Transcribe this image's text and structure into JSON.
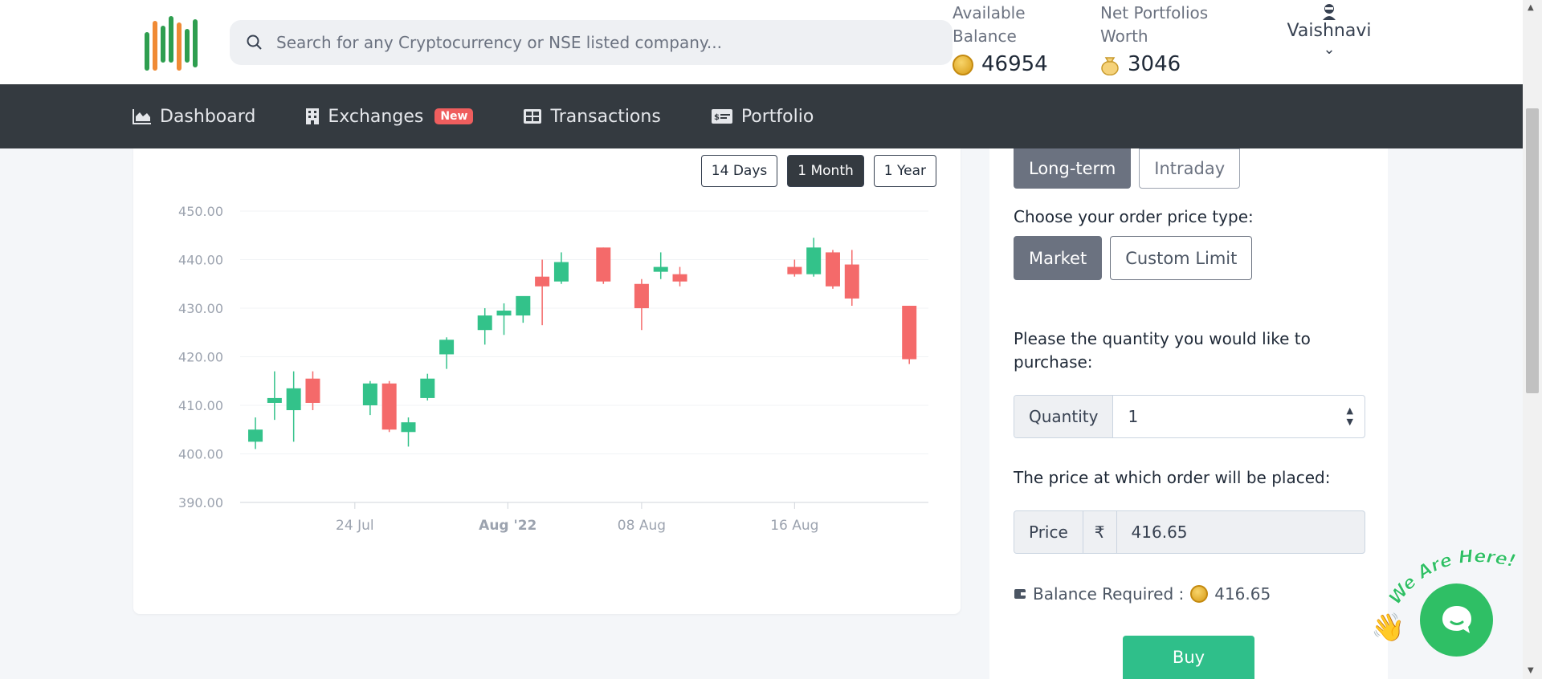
{
  "header": {
    "search_placeholder": "Search for any Cryptocurrency or NSE listed company...",
    "available_balance_label": "Available Balance",
    "available_balance": "46954",
    "net_worth_label": "Net Portfolios Worth",
    "net_worth": "3046",
    "user_name": "Vaishnavi"
  },
  "nav": [
    {
      "label": "Dashboard",
      "icon": "chart-area-icon"
    },
    {
      "label": "Exchanges",
      "icon": "building-icon",
      "badge": "New"
    },
    {
      "label": "Transactions",
      "icon": "table-icon"
    },
    {
      "label": "Portfolio",
      "icon": "money-check-icon"
    }
  ],
  "range_buttons": [
    "14 Days",
    "1 Month",
    "1 Year"
  ],
  "range_selected": "1 Month",
  "order": {
    "tabs": [
      "Long-term",
      "Intraday"
    ],
    "tab_selected": "Long-term",
    "price_type_label": "Choose your order price type:",
    "price_types": [
      "Market",
      "Custom Limit"
    ],
    "price_type_selected": "Market",
    "quantity_prompt": "Please the quantity you would like to purchase:",
    "quantity_label": "Quantity",
    "quantity_value": "1",
    "price_prompt": "The price at which order will be placed:",
    "price_label": "Price",
    "currency_symbol": "₹",
    "price_value": "416.65",
    "balance_required_label": "Balance Required :",
    "balance_required": "416.65",
    "buy_label": "Buy"
  },
  "chat": {
    "banner": "We Are Here!"
  },
  "colors": {
    "up": "#33c28a",
    "down": "#f46a6a",
    "nav_bg": "#343a40",
    "buy": "#2fbf8a"
  },
  "chart_data": {
    "type": "candlestick",
    "ylim": [
      390,
      450
    ],
    "y_ticks": [
      "450.00",
      "440.00",
      "430.00",
      "420.00",
      "410.00",
      "400.00",
      "390.00"
    ],
    "x_ticks": [
      {
        "label": "24 Jul",
        "day": 6,
        "bold": false
      },
      {
        "label": "Aug '22",
        "day": 14,
        "bold": true
      },
      {
        "label": "08 Aug",
        "day": 21,
        "bold": false
      },
      {
        "label": "16 Aug",
        "day": 29,
        "bold": false
      }
    ],
    "candles": [
      {
        "day": 0.8,
        "o": 402.5,
        "h": 407.5,
        "l": 401,
        "c": 405
      },
      {
        "day": 1.8,
        "o": 410.5,
        "h": 417,
        "l": 407,
        "c": 411.5
      },
      {
        "day": 2.8,
        "o": 409,
        "h": 417,
        "l": 402.5,
        "c": 413.5
      },
      {
        "day": 3.8,
        "o": 415.5,
        "h": 417,
        "l": 409,
        "c": 410.5
      },
      {
        "day": 6.8,
        "o": 410,
        "h": 415,
        "l": 408,
        "c": 414.5
      },
      {
        "day": 7.8,
        "o": 414.5,
        "h": 415,
        "l": 404.5,
        "c": 405
      },
      {
        "day": 8.8,
        "o": 404.5,
        "h": 407.5,
        "l": 401.5,
        "c": 406.5
      },
      {
        "day": 9.8,
        "o": 411.5,
        "h": 416.5,
        "l": 411,
        "c": 415.5
      },
      {
        "day": 10.8,
        "o": 420.5,
        "h": 424,
        "l": 417.5,
        "c": 423.5
      },
      {
        "day": 12.8,
        "o": 425.5,
        "h": 430,
        "l": 422.5,
        "c": 428.5
      },
      {
        "day": 13.8,
        "o": 428.5,
        "h": 431,
        "l": 424.5,
        "c": 429.5
      },
      {
        "day": 14.8,
        "o": 428.5,
        "h": 431.5,
        "l": 427,
        "c": 432.5
      },
      {
        "day": 15.8,
        "o": 436.5,
        "h": 440,
        "l": 426.5,
        "c": 434.5
      },
      {
        "day": 16.8,
        "o": 435.5,
        "h": 441.5,
        "l": 435,
        "c": 439.5
      },
      {
        "day": 19,
        "o": 442.5,
        "h": 442.5,
        "l": 435,
        "c": 435.5
      },
      {
        "day": 21,
        "o": 435,
        "h": 436,
        "l": 425.5,
        "c": 430
      },
      {
        "day": 22,
        "o": 437.5,
        "h": 441.5,
        "l": 436,
        "c": 438.5
      },
      {
        "day": 23,
        "o": 437,
        "h": 438.5,
        "l": 434.5,
        "c": 435.5
      },
      {
        "day": 29,
        "o": 438.5,
        "h": 440,
        "l": 436.5,
        "c": 437
      },
      {
        "day": 30,
        "o": 437,
        "h": 444.5,
        "l": 436.5,
        "c": 442.5
      },
      {
        "day": 31,
        "o": 441.5,
        "h": 442,
        "l": 434,
        "c": 434.5
      },
      {
        "day": 32,
        "o": 439,
        "h": 442,
        "l": 430.5,
        "c": 432
      },
      {
        "day": 35,
        "o": 430.5,
        "h": 430.5,
        "l": 418.5,
        "c": 419.5
      }
    ]
  }
}
